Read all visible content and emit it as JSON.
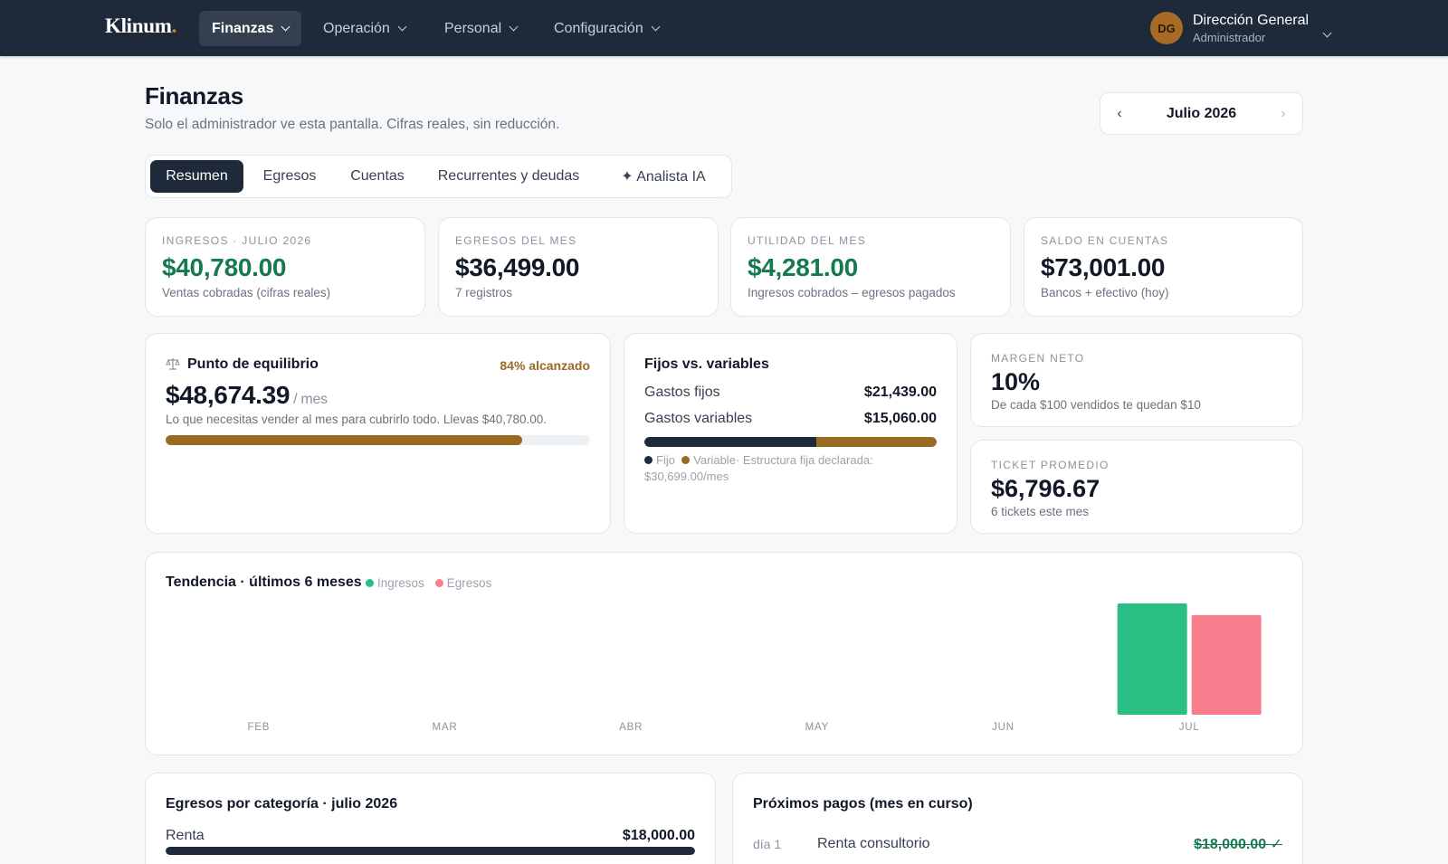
{
  "app": {
    "logo_text": "Klinum",
    "logo_dot": "."
  },
  "nav": {
    "items": [
      {
        "label": "Finanzas",
        "active": true
      },
      {
        "label": "Operación",
        "active": false
      },
      {
        "label": "Personal",
        "active": false
      },
      {
        "label": "Configuración",
        "active": false
      }
    ]
  },
  "user": {
    "initials": "DG",
    "name": "Dirección General",
    "role": "Administrador"
  },
  "header": {
    "title": "Finanzas",
    "subtitle": "Solo el administrador ve esta pantalla. Cifras reales, sin reducción.",
    "month": "Julio 2026",
    "prev_icon": "‹",
    "next_icon": "›"
  },
  "tabs": [
    {
      "label": "Resumen",
      "active": true
    },
    {
      "label": "Egresos",
      "active": false
    },
    {
      "label": "Cuentas",
      "active": false
    },
    {
      "label": "Recurrentes y deudas",
      "active": false
    },
    {
      "label": "✦ Analista IA",
      "active": false
    }
  ],
  "kpis": [
    {
      "label": "Ingresos · Julio 2026",
      "value": "$40,780.00",
      "note": "Ventas cobradas (cifras reales)",
      "color": "#157a4f"
    },
    {
      "label": "Egresos del mes",
      "value": "$36,499.00",
      "note": "7 registros",
      "color": "#111827"
    },
    {
      "label": "Utilidad del mes",
      "value": "$4,281.00",
      "note": "Ingresos cobrados – egresos pagados",
      "color": "#157a4f"
    },
    {
      "label": "Saldo en cuentas",
      "value": "$73,001.00",
      "note": "Bancos + efectivo (hoy)",
      "color": "#111827"
    }
  ],
  "breakeven": {
    "title": "Punto de equilibrio",
    "badge": "84% alcanzado",
    "value": "$48,674.39",
    "unit": "/ mes",
    "note": "Lo que necesitas vender al mes para cubrirlo todo. Llevas $40,780.00.",
    "progress": 0.84,
    "bar_color": "#9a6a23"
  },
  "fixed_variable": {
    "title": "Fijos vs. variables",
    "fixed_label": "Gastos fijos",
    "fixed_value": "$21,439.00",
    "variable_label": "Gastos variables",
    "variable_value": "$15,060.00",
    "fixed_share": 0.5874,
    "fixed_color": "#1e2a3a",
    "variable_color": "#9a6a23",
    "legend_fixed": "Fijo",
    "legend_variable": "Variable",
    "legend_note": "· Estructura fija declarada: $30,699.00/mes"
  },
  "net_margin": {
    "label": "Margen neto",
    "value": "10%",
    "note": "De cada $100 vendidos te quedan $10"
  },
  "avg_ticket": {
    "label": "Ticket promedio",
    "value": "$6,796.67",
    "note": "6 tickets este mes"
  },
  "trend": {
    "title": "Tendencia · últimos 6 meses",
    "legend_income": "Ingresos",
    "legend_expense": "Egresos",
    "income_color": "#2bbf85",
    "expense_color": "#f87d8d"
  },
  "chart_data": {
    "type": "bar",
    "title": "Tendencia · últimos 6 meses",
    "categories": [
      "FEB",
      "MAR",
      "ABR",
      "MAY",
      "JUN",
      "JUL"
    ],
    "series": [
      {
        "name": "Ingresos",
        "values": [
          0,
          0,
          0,
          0,
          0,
          40780
        ]
      },
      {
        "name": "Egresos",
        "values": [
          0,
          0,
          0,
          0,
          0,
          36499
        ]
      }
    ],
    "ylim": [
      0,
      40780
    ],
    "grid": false,
    "legend": "top-left"
  },
  "categories_card": {
    "title": "Egresos por categoría · julio 2026",
    "rows": [
      {
        "label": "Renta",
        "value": "$18,000.00",
        "share": 1.0
      }
    ],
    "bar_color": "#1e2a3a"
  },
  "payments_card": {
    "title": "Próximos pagos (mes en curso)",
    "rows": [
      {
        "day": "día 1",
        "name": "Renta consultorio",
        "amount": "$18,000.00 ✓"
      }
    ]
  }
}
